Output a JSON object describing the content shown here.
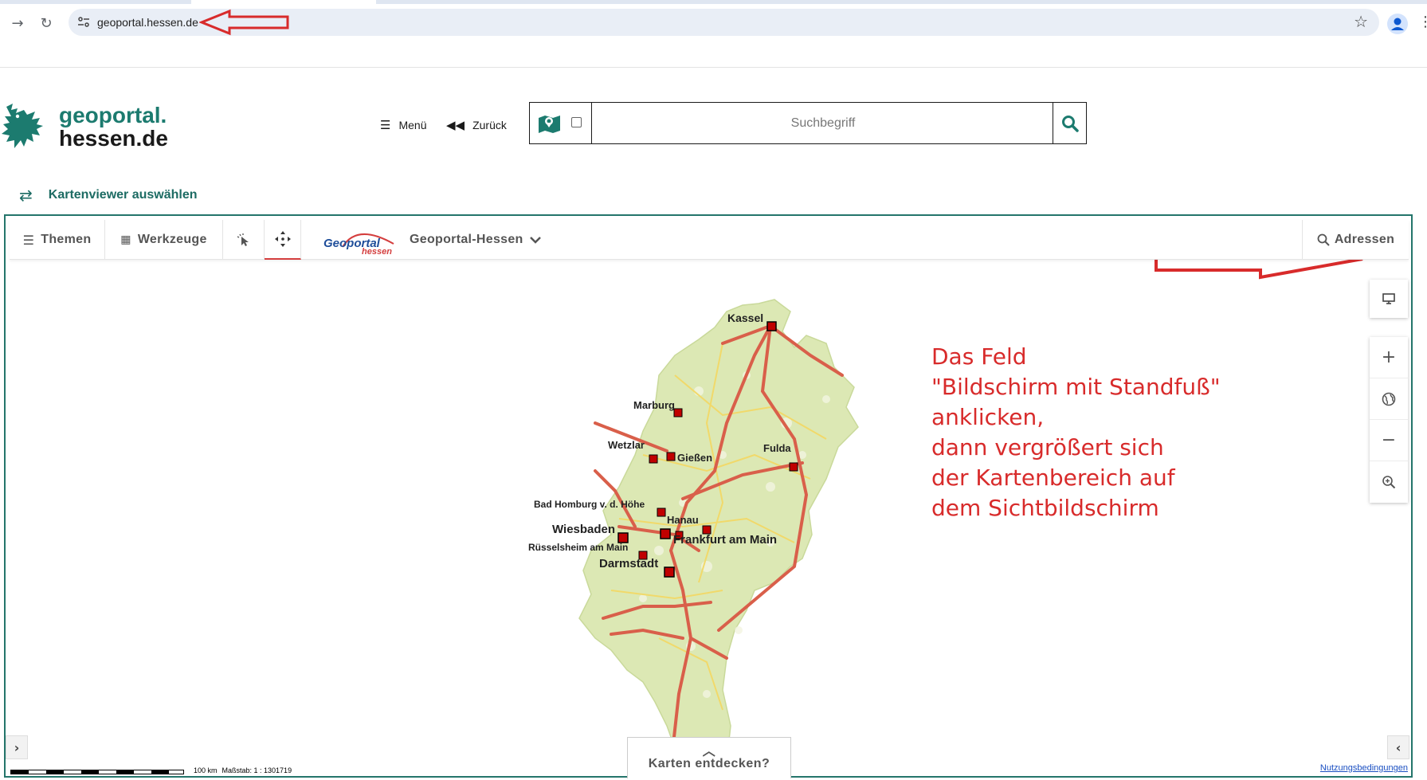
{
  "browser": {
    "url": "geoportal.hessen.de",
    "back_icon": "arrow-right-icon",
    "reload_icon": "reload-icon",
    "star_icon": "star-icon"
  },
  "header": {
    "logo_line1": "geoportal.",
    "logo_line2": "hessen.de",
    "menu_label": "Menü",
    "back_label": "Zurück",
    "search_placeholder": "Suchbegriff",
    "viewer_select_label": "Kartenviewer auswählen"
  },
  "toolbar": {
    "themes_label": "Themen",
    "tools_label": "Werkzeuge",
    "logo_main": "Geoportal",
    "logo_sub": "hessen",
    "portal_label": "Geoportal-Hessen",
    "address_label": "Adressen"
  },
  "map": {
    "cities": [
      {
        "name": "Kassel"
      },
      {
        "name": "Marburg"
      },
      {
        "name": "Wetzlar"
      },
      {
        "name": "Gießen"
      },
      {
        "name": "Fulda"
      },
      {
        "name": "Bad Homburg v. d. Höhe"
      },
      {
        "name": "Hanau"
      },
      {
        "name": "Wiesbaden"
      },
      {
        "name": "Frankfurt am Main"
      },
      {
        "name": "Rüsselsheim am Main"
      },
      {
        "name": "Darmstadt"
      }
    ],
    "instruction_text": "Das Feld\n\"Bildschirm mit Standfuß\"\nanklicken,\ndann vergrößert sich\nder Kartenbereich auf\ndem Sichtbildschirm",
    "discover_label": "Karten entdecken?",
    "scale_distance": "100 km",
    "scale_text": "Maßstab: 1 : 1301719",
    "terms_label": "Nutzungsbedingungen"
  },
  "colors": {
    "brand_green": "#1c7b6f",
    "annotation_red": "#d82b2b",
    "map_land": "#dce8b4",
    "map_roads": "#d95f4a"
  }
}
